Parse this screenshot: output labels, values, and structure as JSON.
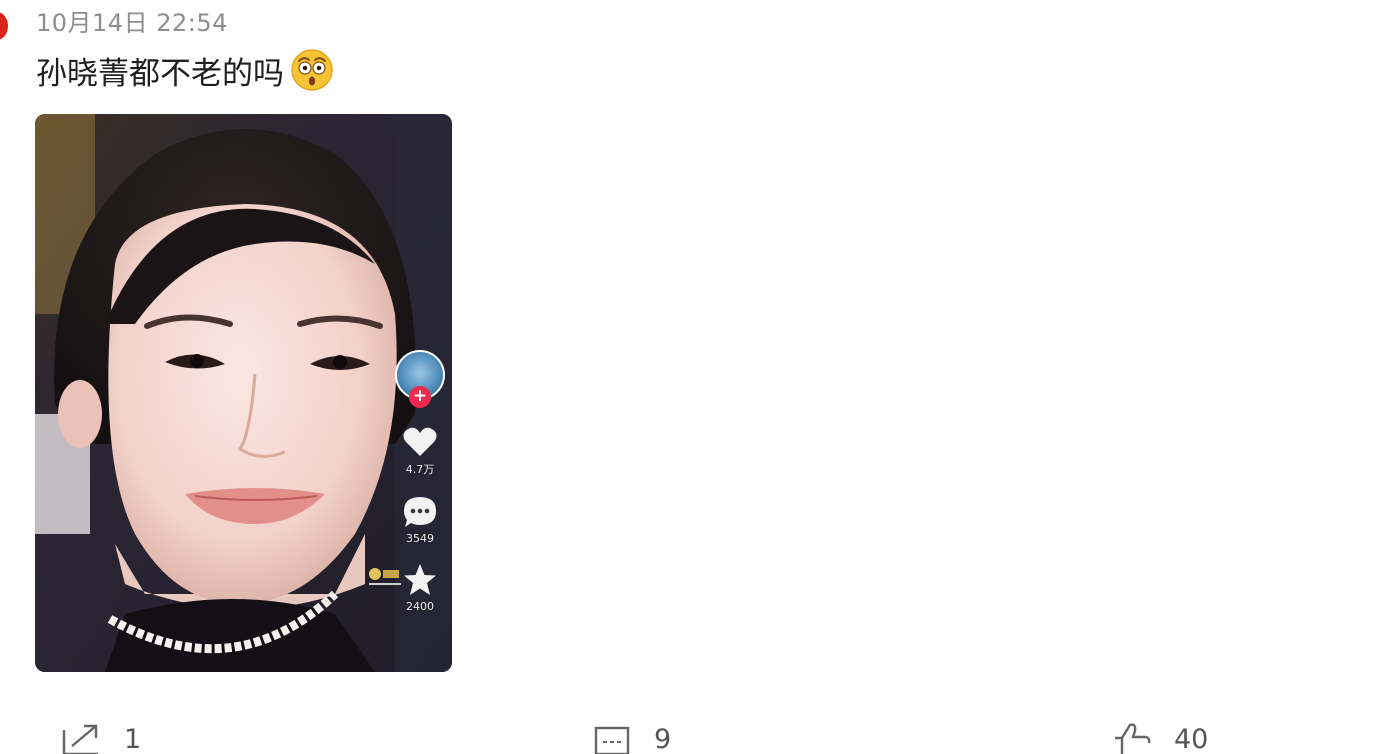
{
  "post": {
    "timestamp": "10月14日 22:54",
    "text": "孙晓菁都不老的吗",
    "emoji": "astonished-face-emoji"
  },
  "video": {
    "likes": "4.7万",
    "comments": "3549",
    "favorites": "2400",
    "follow_symbol": "+"
  },
  "footer": {
    "shares": "1",
    "comments": "9",
    "likes": "40"
  },
  "colors": {
    "timestamp": "#8d8d8d",
    "follow_badge": "#f02a4c",
    "footer_text": "#555555"
  }
}
